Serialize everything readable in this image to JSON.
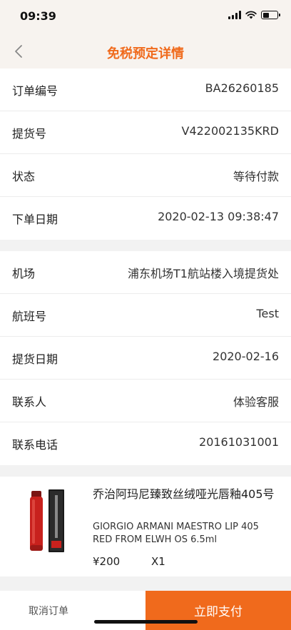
{
  "status_bar": {
    "time": "09:39",
    "battery_level": 0.45
  },
  "nav": {
    "title": "免税预定详情",
    "accent_color": "#f06a1c"
  },
  "order_info": [
    {
      "label": "订单编号",
      "value": "BA26260185"
    },
    {
      "label": "提货号",
      "value": "V422002135KRD"
    },
    {
      "label": "状态",
      "value": "等待付款"
    },
    {
      "label": "下单日期",
      "value": "2020-02-13 09:38:47"
    }
  ],
  "pickup_info": [
    {
      "label": "机场",
      "value": "浦东机场T1航站楼入境提货处"
    },
    {
      "label": "航班号",
      "value": "Test"
    },
    {
      "label": "提货日期",
      "value": "2020-02-16"
    },
    {
      "label": "联系人",
      "value": "体验客服"
    },
    {
      "label": "联系电话",
      "value": "20161031001"
    }
  ],
  "product": {
    "name_cn": "乔治阿玛尼臻致丝绒哑光唇釉405号",
    "name_en": "GIORGIO ARMANI MAESTRO LIP 405 RED FROM ELWH OS 6.5ml",
    "price": "¥200",
    "quantity": "X1",
    "image": "lipstick-product-image"
  },
  "actions": {
    "cancel_label": "取消订单",
    "pay_label": "立即支付"
  }
}
